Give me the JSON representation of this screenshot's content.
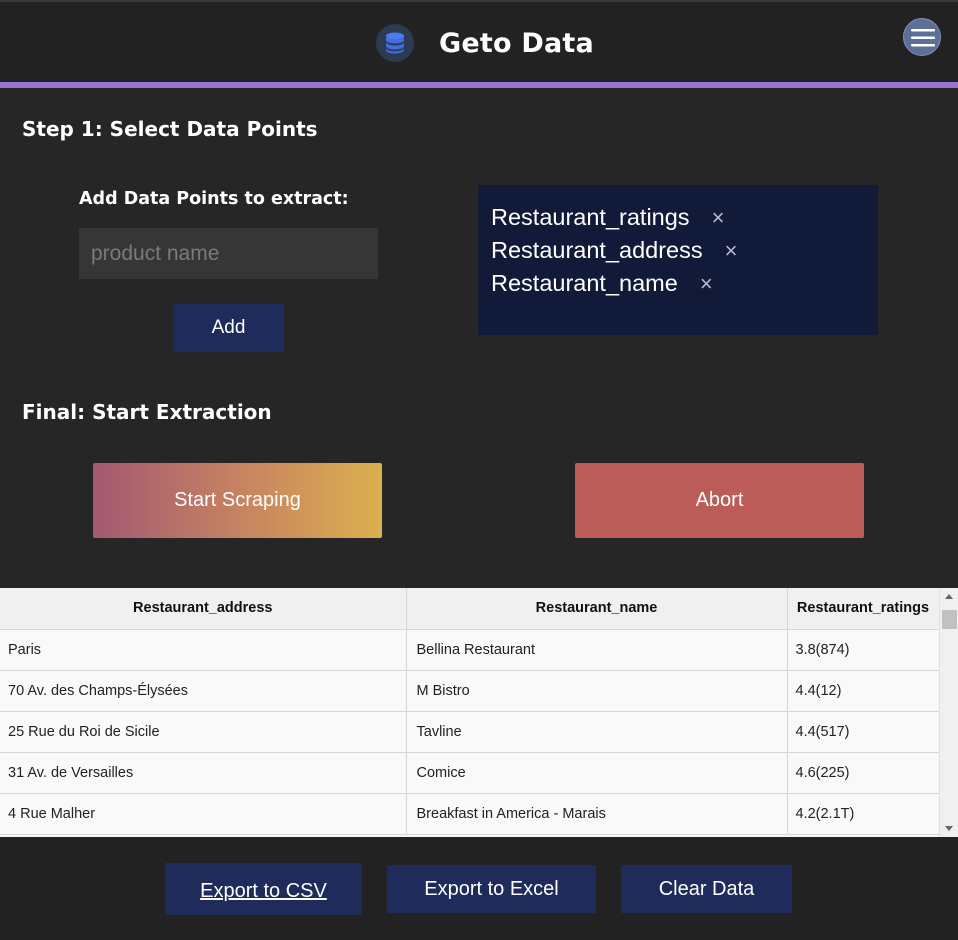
{
  "header": {
    "title": "Geto Data",
    "logo_icon": "database-icon",
    "menu_icon": "hamburger-menu-icon",
    "accent_color": "#9a73d6"
  },
  "step1": {
    "title": "Step 1: Select Data Points",
    "add_label": "Add Data Points to extract:",
    "input_placeholder": "product name",
    "input_value": "",
    "add_button": "Add",
    "data_points": [
      {
        "label": "Restaurant_ratings"
      },
      {
        "label": "Restaurant_address"
      },
      {
        "label": "Restaurant_name"
      }
    ],
    "remove_glyph": "×"
  },
  "final": {
    "title": "Final: Start Extraction",
    "start_button": "Start Scraping",
    "abort_button": "Abort"
  },
  "table": {
    "columns": [
      "Restaurant_address",
      "Restaurant_name",
      "Restaurant_ratings"
    ],
    "rows": [
      [
        "Paris",
        "Bellina Restaurant",
        "3.8(874)"
      ],
      [
        "70 Av. des Champs-Élysées",
        "M Bistro",
        "4.4(12)"
      ],
      [
        "25 Rue du Roi de Sicile",
        "Tavline",
        "4.4(517)"
      ],
      [
        "31 Av. de Versailles",
        "Comice",
        "4.6(225)"
      ],
      [
        "4 Rue Malher",
        "Breakfast in America - Marais",
        "4.2(2.1T)"
      ]
    ]
  },
  "footer": {
    "export_csv": "Export to CSV",
    "export_excel": "Export to Excel",
    "clear_data": "Clear Data"
  }
}
